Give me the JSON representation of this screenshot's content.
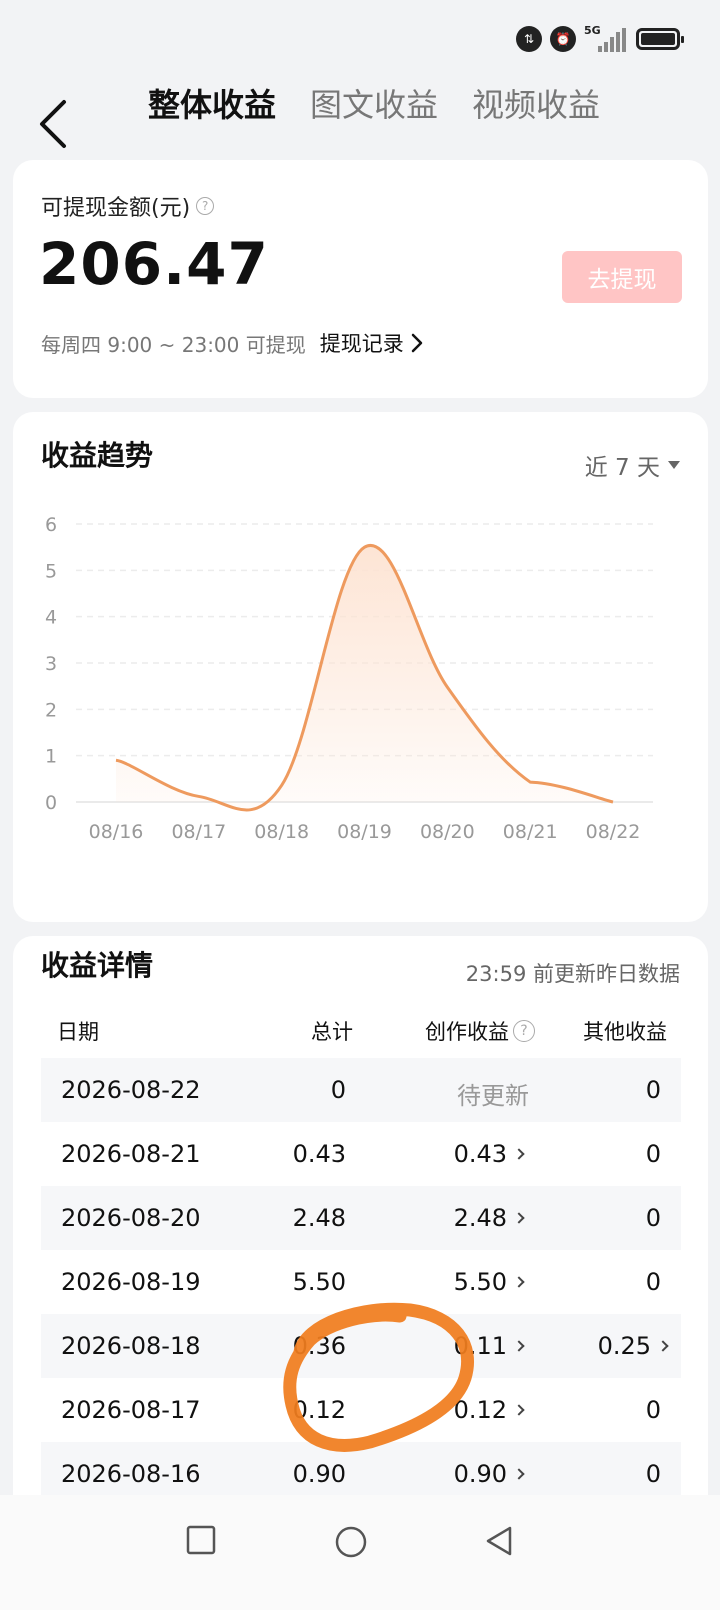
{
  "status_bar": {
    "network": "5G",
    "icons": [
      "data-speed-icon",
      "alarm-icon",
      "signal-icon",
      "battery-icon"
    ]
  },
  "header": {
    "tabs": [
      {
        "label": "整体收益",
        "active": true
      },
      {
        "label": "图文收益",
        "active": false
      },
      {
        "label": "视频收益",
        "active": false
      }
    ]
  },
  "balance": {
    "label": "可提现金额(元)",
    "amount": "206.47",
    "withdraw_button": "去提现",
    "note": "每周四 9:00 ~ 23:00 可提现",
    "record_link": "提现记录"
  },
  "trend": {
    "title": "收益趋势",
    "range": "近 7 天"
  },
  "chart_data": {
    "type": "area",
    "x": [
      "08/16",
      "08/17",
      "08/18",
      "08/19",
      "08/20",
      "08/21",
      "08/22"
    ],
    "y_ticks": [
      "0",
      "1",
      "2",
      "3",
      "4",
      "5",
      "6"
    ],
    "ylim": [
      0,
      6
    ],
    "series": [
      {
        "values": [
          0.9,
          0.12,
          0.36,
          5.5,
          2.48,
          0.43,
          0
        ]
      }
    ],
    "colors": {
      "line": "#ee9a5e",
      "fill": "#fde3d2"
    },
    "grid": true
  },
  "details": {
    "title": "收益详情",
    "update_note": "23:59 前更新昨日数据",
    "columns": [
      "日期",
      "总计",
      "创作收益",
      "其他收益"
    ],
    "rows": [
      {
        "date": "2026-08-22",
        "total": "0",
        "creation": "待更新",
        "other": "0"
      },
      {
        "date": "2026-08-21",
        "total": "0.43",
        "creation": "0.43",
        "other": "0"
      },
      {
        "date": "2026-08-20",
        "total": "2.48",
        "creation": "2.48",
        "other": "0"
      },
      {
        "date": "2026-08-19",
        "total": "5.50",
        "creation": "5.50",
        "other": "0"
      },
      {
        "date": "2026-08-18",
        "total": "0.36",
        "creation": "0.11",
        "other": "0.25"
      },
      {
        "date": "2026-08-17",
        "total": "0.12",
        "creation": "0.12",
        "other": "0"
      },
      {
        "date": "2026-08-16",
        "total": "0.90",
        "creation": "0.90",
        "other": "0"
      }
    ]
  },
  "annotation": {
    "color": "#f07d1e"
  }
}
